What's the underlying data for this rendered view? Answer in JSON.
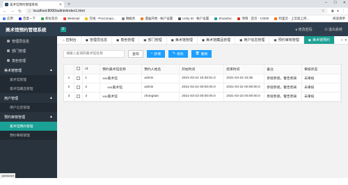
{
  "browser": {
    "tab_title": "美术馆预约管理系统",
    "url": "localhost:8080/admin/index1.html",
    "bookmarks": [
      {
        "label": "应用",
        "color": "#4285f4"
      },
      {
        "label": "百度一下",
        "color": "#2932e1"
      },
      {
        "label": "新标签页",
        "color": "#34a853"
      },
      {
        "label": "Webmail",
        "color": "#ea4335"
      },
      {
        "label": "在线 - ProCompo...",
        "color": "#fbbc05"
      },
      {
        "label": "微服务",
        "color": "#888888"
      },
      {
        "label": "漫画开始 - 帐户设置",
        "color": "#e67e22"
      },
      {
        "label": "Unity ID - 帐户设置",
        "color": "#555555"
      },
      {
        "label": "ShowDoc",
        "color": "#1aa094"
      },
      {
        "label": "项目 · 首页 - CODE",
        "color": "#d93025"
      },
      {
        "label": "阿里云 - 上云就上阿...",
        "color": "#ff6a00"
      }
    ],
    "bookmarks_right": "阅读清单"
  },
  "header": {
    "title": "美术馆预约管理系统",
    "menu_toggle": "≡",
    "change_password": "修改密码",
    "logout": "退出系统"
  },
  "sidebar": {
    "top_items": [
      "管理员信息",
      "部门管理",
      "角色管理"
    ],
    "groups": [
      {
        "label": "美术馆管理",
        "arrow": "▲",
        "subs": [
          "美术馆管理",
          "美术馆藏品管理"
        ]
      },
      {
        "label": "用户管理",
        "arrow": "▲",
        "subs": [
          "用户信息管理"
        ]
      },
      {
        "label": "预约审核管理",
        "arrow": "▲",
        "subs": [
          "美术馆预约管理",
          "预约审核管理"
        ]
      }
    ],
    "bottom_label": "javascript:;"
  },
  "tabs": [
    "控制台",
    "管理员信息",
    "角色管理",
    "部门管理",
    "美术馆管理",
    "美术馆藏品管理",
    "用户信息管理",
    "预约审核管理",
    "美术馆预约"
  ],
  "toolbar": {
    "search_placeholder": "请输入查询的美术馆名称",
    "query": "查询",
    "add": "新增",
    "edit": "修改",
    "delete": "删除"
  },
  "table": {
    "headers": [
      "",
      "id",
      "预约美术馆名称",
      "预约人姓名",
      "开始时间",
      "结束时间",
      "备注",
      "审核状态"
    ],
    "rows": [
      {
        "num": "1",
        "id": "1",
        "name": "xxx美术馆",
        "person": "admin",
        "start": "2021-03-22 15:36:51.0",
        "end": "2021-03-22 15:36",
        "note": "参观参观，警告而来",
        "status": "未审核"
      },
      {
        "num": "2",
        "id": "2",
        "name": "xxx美术馆",
        "person": "admin",
        "start": "2021-03-22 00:00:00.0",
        "end": "2021-03-22 00:00:00.0",
        "note": "参观参观，警告而来",
        "status": "未审核"
      },
      {
        "num": "3",
        "id": "3",
        "name": "xxx美术馆",
        "person": "zhangsan",
        "start": "2021-03-23 00:00:00.0",
        "end": "2021-03-23 00:00:00.0",
        "note": "参观参观，警告而来",
        "status": "未审核"
      }
    ]
  }
}
